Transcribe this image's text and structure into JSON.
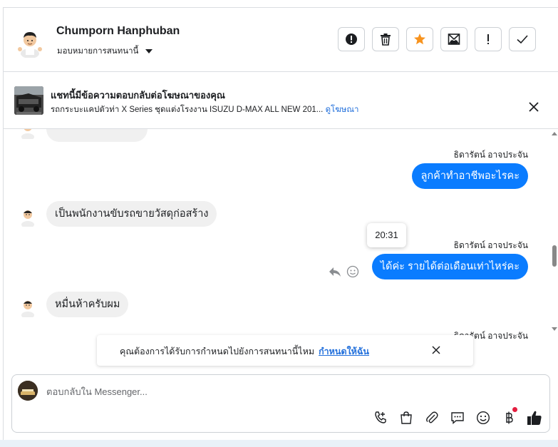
{
  "header": {
    "contact_name": "Chumporn Hanphuban",
    "assign_label": "มอบหมายการสนทนานี้",
    "actions": [
      {
        "name": "spam-button",
        "icon": "alert-circle-icon"
      },
      {
        "name": "delete-button",
        "icon": "trash-icon"
      },
      {
        "name": "star-button",
        "icon": "star-icon"
      },
      {
        "name": "mark-unread-button",
        "icon": "mail-icon"
      },
      {
        "name": "follow-up-button",
        "icon": "exclamation-icon"
      },
      {
        "name": "mark-done-button",
        "icon": "check-icon"
      }
    ]
  },
  "ad": {
    "title": "แชทนี้มีข้อความตอบกลับต่อโฆษณาของคุณ",
    "subtitle": "รถกระบะแคปตัวท่า X Series ชุดแต่งโรงงาน ISUZU D-MAX ALL NEW 201...",
    "link": "ดูโฆษณา"
  },
  "thread": {
    "messages": [
      {
        "sender": "ธิดารัตน์ อาจประจัน",
        "text": "ลูกค้าทำอาชีพอะไรคะ",
        "direction": "out"
      },
      {
        "text": "เป็นพนักงานขับรถขายวัสดุก่อสร้าง",
        "direction": "in"
      },
      {
        "sender": "ธิดารัตน์ อาจประจัน",
        "text": "ได้ค่ะ รายได้ต่อเดือนเท่าไหร่คะ",
        "direction": "out"
      },
      {
        "text": "หมื่นห้าครับผม",
        "direction": "in"
      }
    ],
    "tooltip_time": "20:31",
    "partial_sender": "ธิดารัตน์ อาจประจัน"
  },
  "prompt": {
    "text": "คุณต้องการได้รับการกำหนดไปยังการสนทนานี้ไหม",
    "link": "กำหนดให้ฉัน"
  },
  "composer": {
    "placeholder": "ตอบกลับใน Messenger...",
    "tools": [
      "call-add-icon",
      "shopping-bag-icon",
      "paperclip-icon",
      "saved-reply-icon",
      "emoji-icon",
      "baht-icon",
      "thumbs-up-icon"
    ]
  },
  "colors": {
    "accent": "#0a7cff",
    "link": "#216fdb",
    "star": "#f7931e",
    "notification": "#e41e3f"
  }
}
